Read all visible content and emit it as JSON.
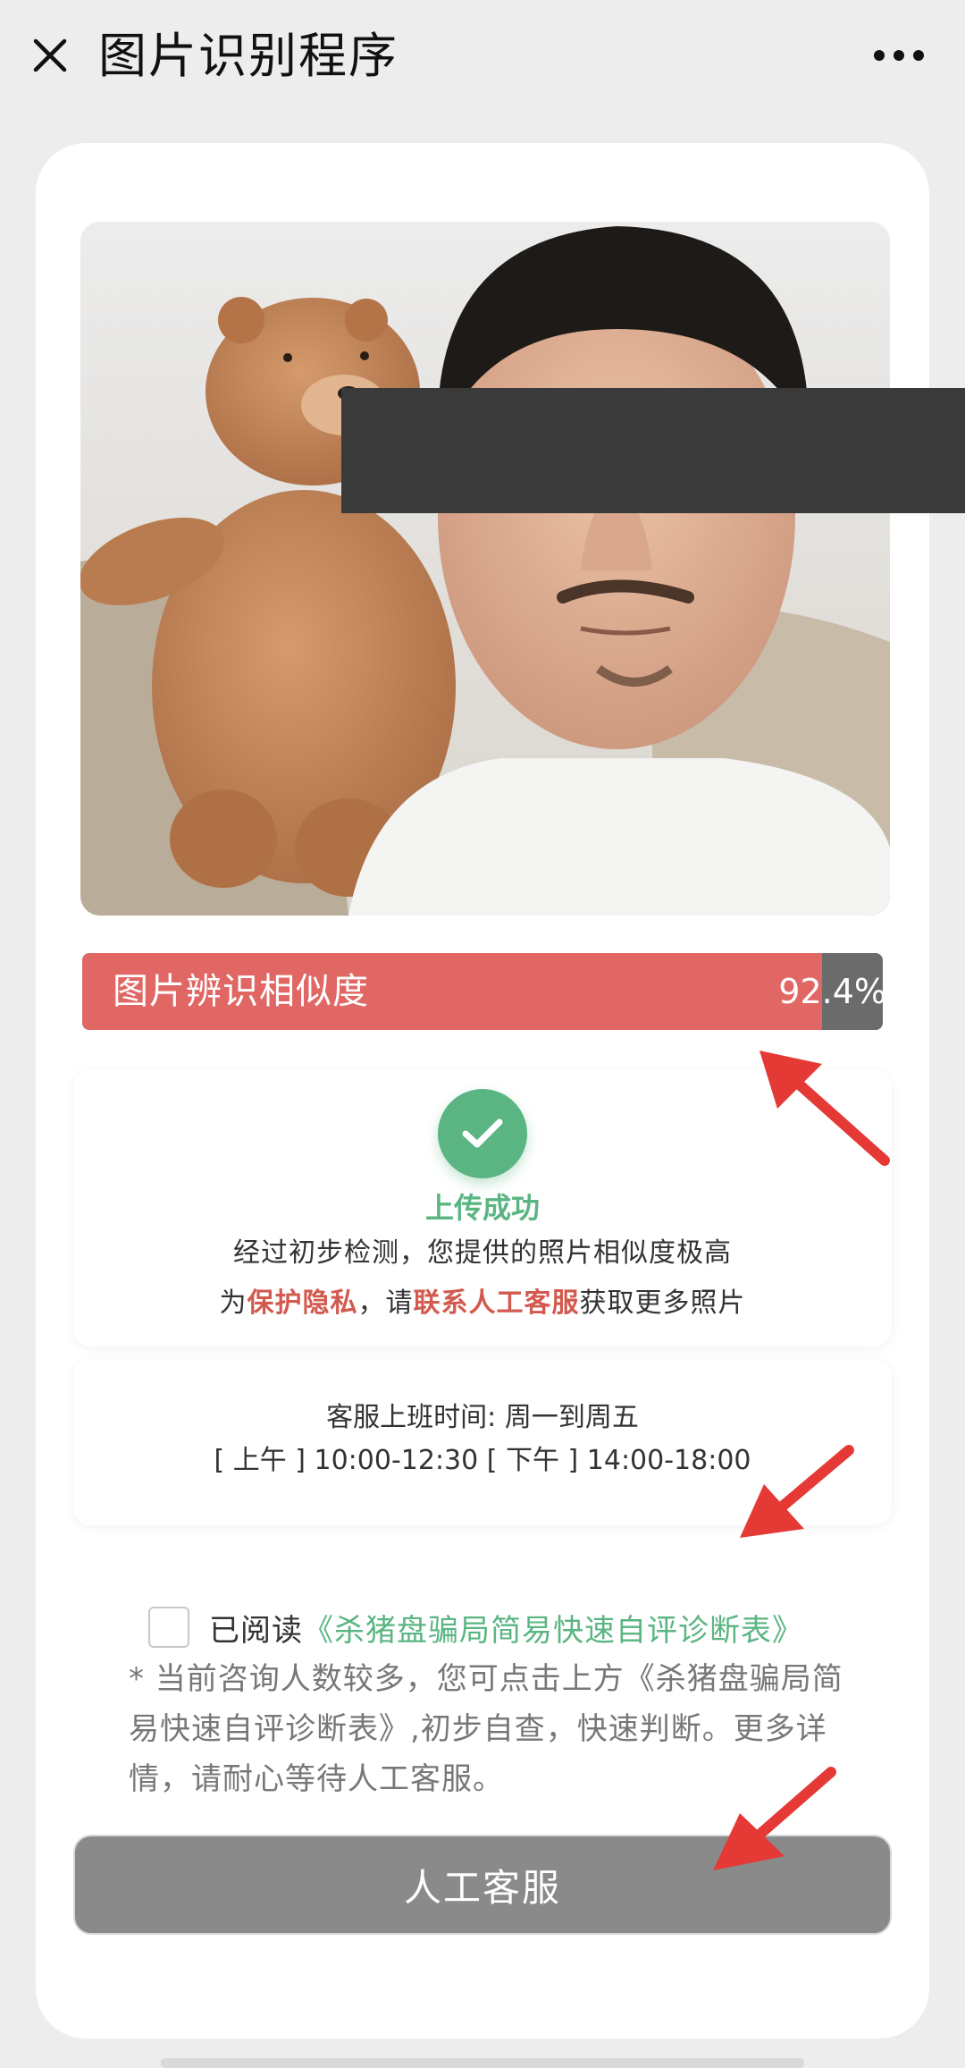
{
  "topbar": {
    "title": "图片识别程序",
    "close_icon": "close-icon",
    "more_icon": "more-dots-icon"
  },
  "photo": {
    "description_icon": "uploaded-photo"
  },
  "similarity": {
    "label": "图片辨识相似度",
    "value_text": "92.4%",
    "value": 0.924,
    "fill_color": "#e06763",
    "track_color": "#6b6b6b"
  },
  "upload_result": {
    "status_icon": "check-circle-icon",
    "title": "上传成功",
    "line1": "经过初步检测，您提供的照片相似度极高",
    "line2_prefix": "为",
    "line2_highlight1": "保护隐私",
    "line2_middle": "，请",
    "line2_highlight2": "联系人工客服",
    "line2_suffix": "获取更多照片",
    "accent_color": "#5ab582",
    "highlight_color": "#d25a4f"
  },
  "service_hours": {
    "line1": "客服上班时间: 周一到周五",
    "line2": "[ 上午 ] 10:00-12:30 [ 下午 ] 14:00-18:00"
  },
  "agreement": {
    "checked": false,
    "prefix": "已阅读",
    "link": "《杀猪盘骗局简易快速自评诊断表》"
  },
  "notice": {
    "text": "* 当前咨询人数较多，您可点击上方《杀猪盘骗局简易快速自评诊断表》,初步自查，快速判断。更多详情，请耐心等待人工客服。"
  },
  "service_button": {
    "label": "人工客服"
  },
  "annotations": {
    "arrow_color": "#e53935"
  }
}
